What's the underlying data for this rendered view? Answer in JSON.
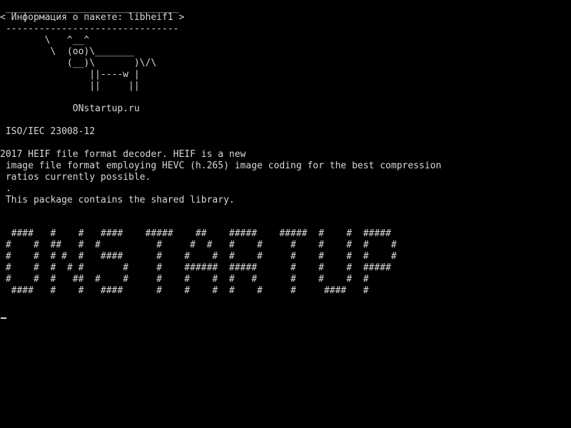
{
  "terminal": {
    "colors": {
      "background": "#000000",
      "foreground": "#d8d8d8"
    },
    "cowsay": {
      "top_border": " _______________________________",
      "speech": "< Информация о пакете: libheif1 >",
      "bottom_border": " -------------------------------",
      "cow": [
        "        \\   ^__^",
        "         \\  (oo)\\_______",
        "            (__)\\       )\\/\\",
        "                ||----w |",
        "                ||     ||"
      ],
      "site": "             ONstartup.ru"
    },
    "section": " ISO/IEC 23008-12",
    "description": [
      "2017 HEIF file format decoder. HEIF is a new",
      " image file format employing HEVC (h.265) image coding for the best compression",
      " ratios currently possible.",
      " .",
      " This package contains the shared library."
    ],
    "banner": [
      "  ####   #    #   ####    #####    ##    #####    #####  #    #  #####",
      " #    #  ##   #  #          #     #  #   #    #     #    #    #  #    #",
      " #    #  # #  #   ####      #    #    #  #    #     #    #    #  #    #",
      " #    #  #  # #       #     #    ######  #####      #    #    #  #####",
      " #    #  #   ##  #    #     #    #    #  #   #      #    #    #  #",
      "  ####   #    #   ####      #    #    #  #    #     #     ####   #"
    ],
    "cursor": "_"
  }
}
